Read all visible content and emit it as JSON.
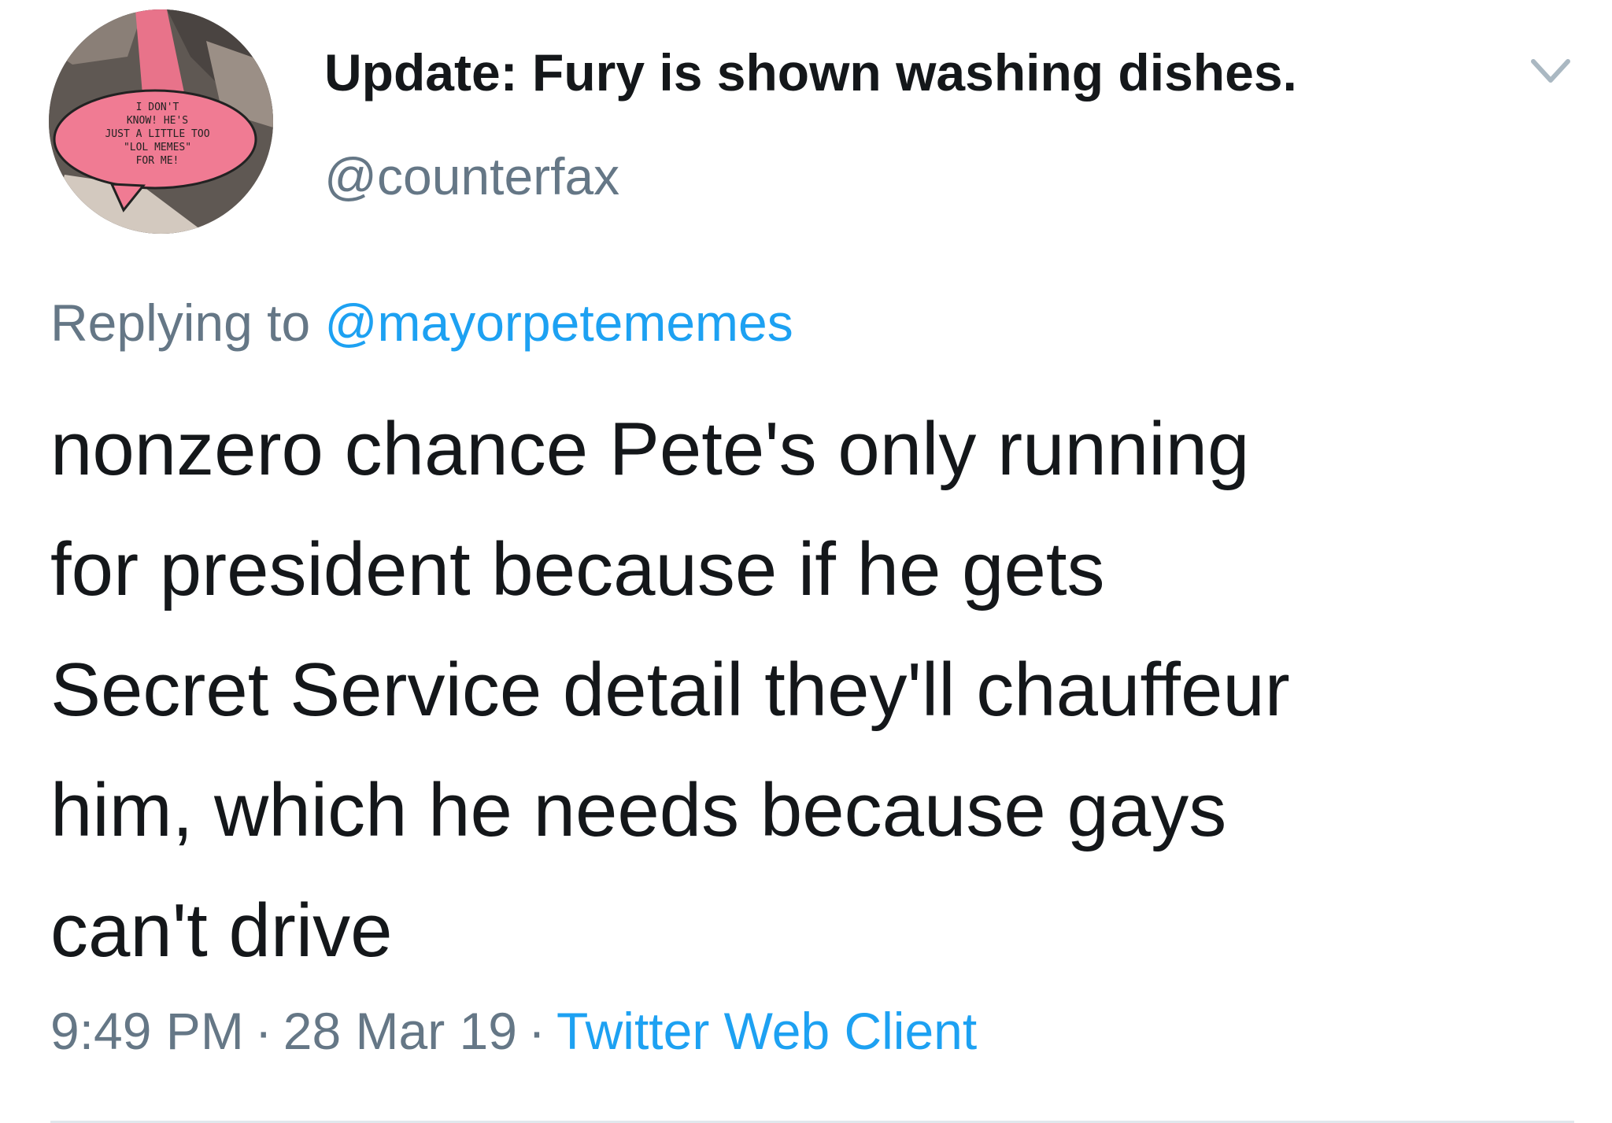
{
  "tweet": {
    "display_name": "Update: Fury is shown washing dishes.",
    "handle": "@counterfax",
    "reply_prefix": "Replying to",
    "reply_to": "@mayorpetememes",
    "text": "nonzero chance Pete's only running\nfor president because if he gets\nSecret Service detail they'll chauffeur\nhim, which he needs because gays\ncan't drive",
    "time": "9:49 PM",
    "separator": "·",
    "date": "28 Mar 19",
    "source": "Twitter Web Client"
  },
  "avatar": {
    "speech_bubble_text": [
      "I DON'T",
      "KNOW! HE'S",
      "JUST A LITTLE TOO",
      "\"LOL MEMES\"",
      "FOR ME!"
    ]
  },
  "icons": {
    "caret": "chevron-down-icon"
  },
  "colors": {
    "text": "#14171a",
    "secondary": "#657786",
    "link": "#1da1f2",
    "divider": "#e1e8ed"
  }
}
